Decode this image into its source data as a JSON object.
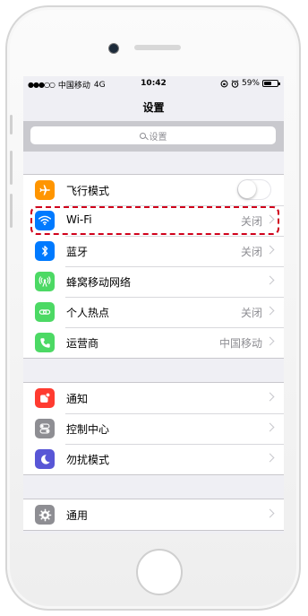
{
  "status_bar": {
    "signal_dots": "●●●○○",
    "carrier": "中国移动",
    "network": "4G",
    "time": "10:42",
    "battery_text": "59%",
    "battery_level": 0.59
  },
  "nav": {
    "title": "设置"
  },
  "search": {
    "placeholder": "设置"
  },
  "groups": [
    {
      "items": [
        {
          "label": "飞行模式",
          "icon": "airplane-icon",
          "icon_bg": "#ff9500",
          "control": "toggle",
          "toggle_on": false
        },
        {
          "label": "Wi-Fi",
          "icon": "wifi-icon",
          "icon_bg": "#007aff",
          "value": "关闭",
          "highlighted": true
        },
        {
          "label": "蓝牙",
          "icon": "bluetooth-icon",
          "icon_bg": "#007aff",
          "value": "关闭"
        },
        {
          "label": "蜂窝移动网络",
          "icon": "cellular-icon",
          "icon_bg": "#4cd964",
          "value": ""
        },
        {
          "label": "个人热点",
          "icon": "hotspot-icon",
          "icon_bg": "#4cd964",
          "value": "关闭"
        },
        {
          "label": "运营商",
          "icon": "phone-icon",
          "icon_bg": "#4cd964",
          "value": "中国移动"
        }
      ]
    },
    {
      "items": [
        {
          "label": "通知",
          "icon": "notifications-icon",
          "icon_bg": "#ff3b30"
        },
        {
          "label": "控制中心",
          "icon": "control-center-icon",
          "icon_bg": "#8e8e93"
        },
        {
          "label": "勿扰模式",
          "icon": "moon-icon",
          "icon_bg": "#5856d6"
        }
      ]
    },
    {
      "items": [
        {
          "label": "通用",
          "icon": "gear-icon",
          "icon_bg": "#8e8e93"
        }
      ]
    }
  ]
}
